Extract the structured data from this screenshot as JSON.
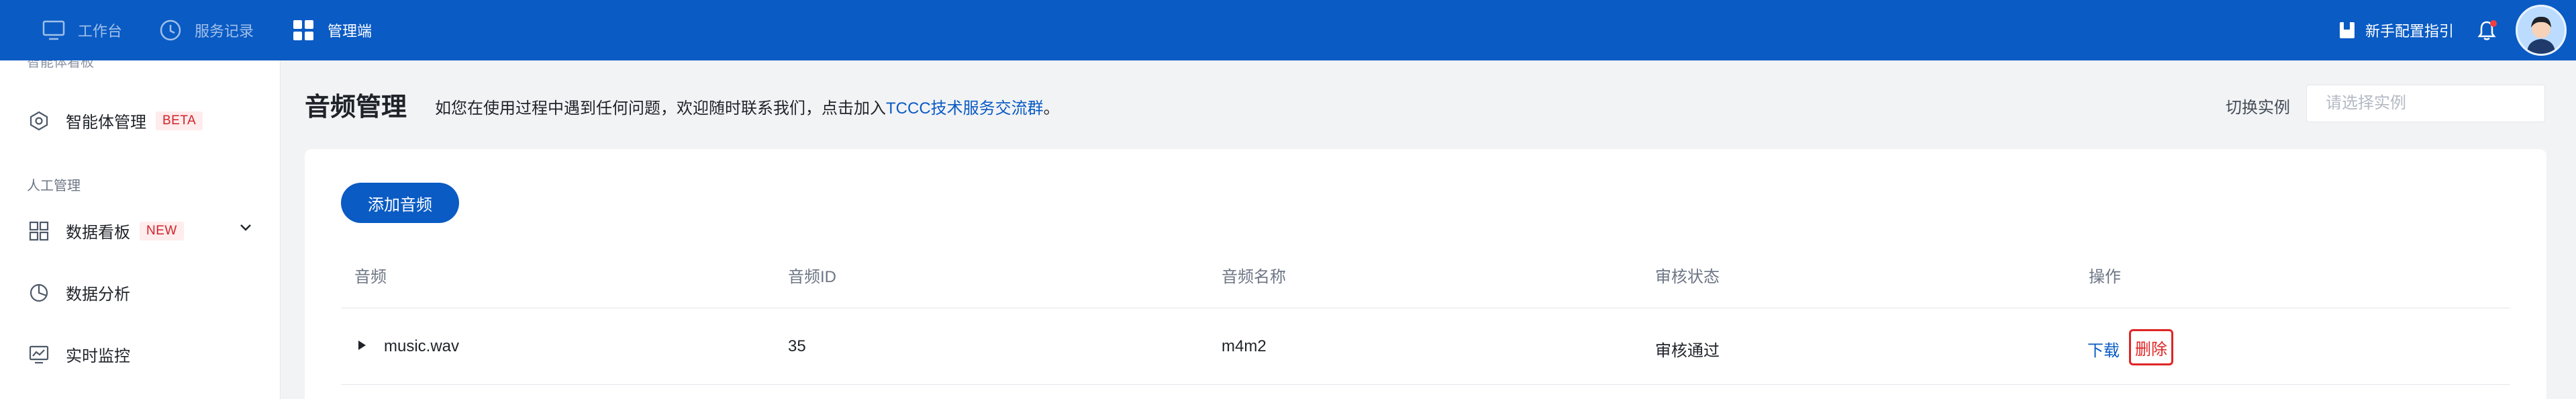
{
  "topbar": {
    "nav": [
      {
        "label": "工作台",
        "icon": "monitor-icon"
      },
      {
        "label": "服务记录",
        "icon": "clock-icon"
      },
      {
        "label": "管理端",
        "icon": "grid-icon"
      }
    ],
    "guide_label": "新手配置指引",
    "guide_icon": "book-icon",
    "bell_icon": "bell-icon",
    "avatar_icon": "avatar-icon"
  },
  "sidebar": {
    "cut_label": "智能体看板",
    "items": [
      {
        "label": "智能体管理",
        "tag": "BETA",
        "icon": "hexagon-icon"
      },
      {
        "label": "数据看板",
        "tag": "NEW",
        "icon": "dashboard-icon"
      },
      {
        "label": "数据分析",
        "icon": "pie-chart-icon"
      },
      {
        "label": "实时监控",
        "icon": "monitor-chart-icon"
      }
    ],
    "group_label": "人工管理"
  },
  "main": {
    "title": "音频管理",
    "notice_prefix": "如您在使用过程中遇到任何问题，欢迎随时联系我们，点击加入",
    "notice_link": "TCCC技术服务交流群",
    "notice_suffix": "。",
    "instance_label": "切换实例",
    "instance_placeholder": "请选择实例",
    "add_button": "添加音频",
    "table": {
      "headers": [
        "音频",
        "音频ID",
        "音频名称",
        "审核状态",
        "操作"
      ],
      "rows": [
        {
          "file": "music.wav",
          "id": "35",
          "name": "m4m2",
          "status": "审核通过",
          "download": "下载",
          "delete": "删除"
        }
      ]
    }
  },
  "colors": {
    "brand": "#0a5bc4",
    "danger": "#e02424",
    "tag_bg": "#ffecec"
  }
}
